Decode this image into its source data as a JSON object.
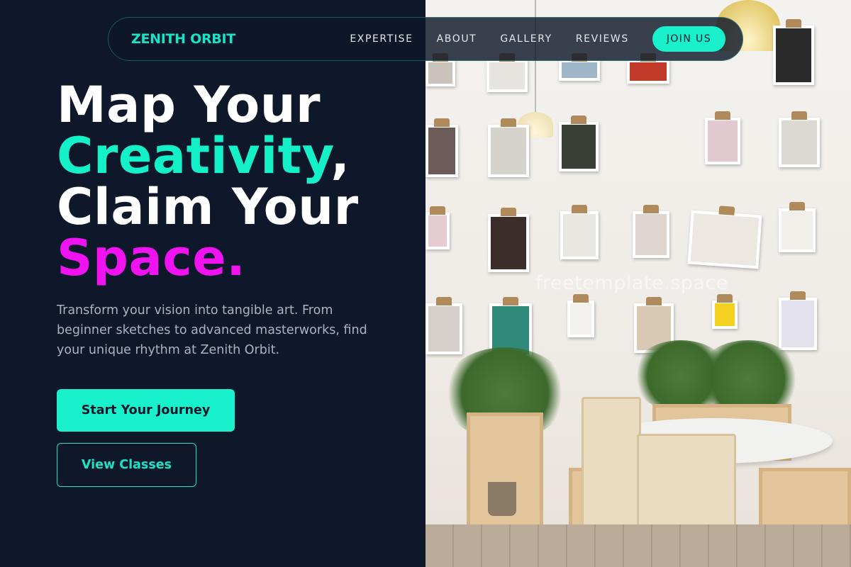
{
  "nav": {
    "brand": "ZENITH ORBIT",
    "links": [
      {
        "label": "EXPERTISE"
      },
      {
        "label": "ABOUT"
      },
      {
        "label": "GALLERY"
      },
      {
        "label": "REVIEWS"
      }
    ],
    "cta": "JOIN US"
  },
  "hero": {
    "line1": "Map Your",
    "line2_highlight": "Creativity",
    "line2_suffix": ",",
    "line3": "Claim Your",
    "line4_highlight": "Space.",
    "subtitle": "Transform your vision into tangible art. From beginner sketches to advanced masterworks, find your unique rhythm at Zenith Orbit.",
    "primary_button": "Start Your Journey",
    "secondary_button": "View Classes"
  },
  "photo": {
    "watermark": "freetemplate.space"
  },
  "colors": {
    "background": "#0f172a",
    "accent_teal": "#19f0cc",
    "accent_magenta": "#f012f0",
    "body_text": "#aab3c2"
  }
}
